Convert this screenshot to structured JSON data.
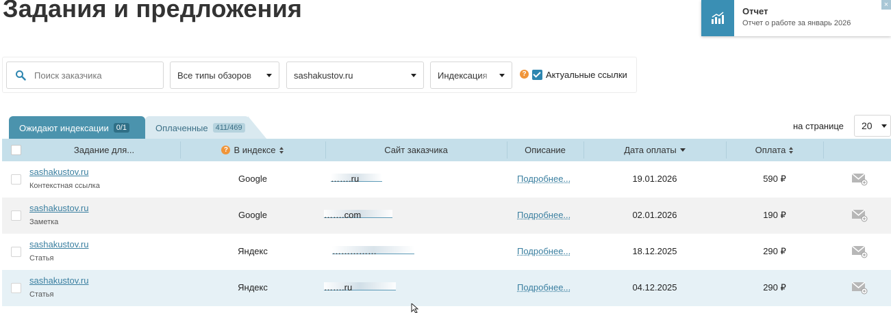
{
  "page": {
    "title": "Задания и предложения"
  },
  "notification": {
    "title": "Отчет",
    "text": "Отчет о работе за январь 2026",
    "close": "×",
    "icon": "chart-icon",
    "accent": "#3a8fb4"
  },
  "filters": {
    "search_placeholder": "Поиск заказчика",
    "review_type": "Все типы обзоров",
    "site": "sashakustov.ru",
    "indexation": "Индексация",
    "help": "?",
    "actual_links_label": "Актуальные ссылки",
    "actual_links_checked": true
  },
  "tabs": [
    {
      "label": "Ожидают индексации",
      "count": "0/1",
      "active": true
    },
    {
      "label": "Оплаченные",
      "count": "411/469",
      "active": false
    }
  ],
  "per_page": {
    "label": "на странице",
    "value": "20"
  },
  "table": {
    "columns": {
      "task": "Задание для...",
      "index_help": "?",
      "index": "В индексе",
      "site": "Сайт заказчика",
      "description": "Описание",
      "pay_date": "Дата оплаты",
      "payment": "Оплата"
    },
    "rows": [
      {
        "task": "sashakustov.ru",
        "type": "Контекстная ссылка",
        "index": "Google",
        "site": "…….ru",
        "description": "Подробнее...",
        "date": "19.01.2026",
        "payment": "590 ₽"
      },
      {
        "task": "sashakustov.ru",
        "type": "Заметка",
        "index": "Google",
        "site": "…….com",
        "description": "Подробнее...",
        "date": "02.01.2026",
        "payment": "190 ₽"
      },
      {
        "task": "sashakustov.ru",
        "type": "Статья",
        "index": "Яндекс",
        "site": "……………",
        "description": "Подробнее...",
        "date": "18.12.2025",
        "payment": "290 ₽"
      },
      {
        "task": "sashakustov.ru",
        "type": "Статья",
        "index": "Яндекс",
        "site": "…….ru",
        "description": "Подробнее...",
        "date": "04.12.2025",
        "payment": "290 ₽"
      }
    ]
  },
  "colors": {
    "header_bg": "#c5dfea",
    "tab_active": "#4b93ad",
    "link": "#3a7fa0",
    "help": "#f0953a"
  }
}
